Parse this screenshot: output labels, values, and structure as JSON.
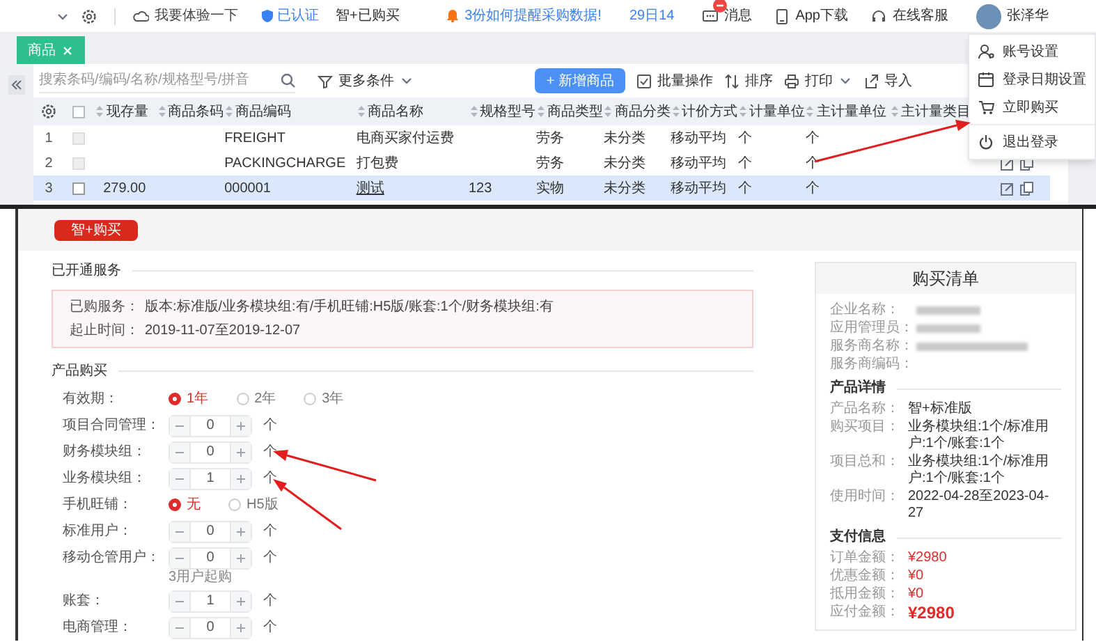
{
  "top_bar": {
    "try_link": "我要体验一下",
    "verified_badge": "已认证",
    "product_name": "智+已购买",
    "notice": "3份如何提醒采购数据!",
    "date": "29日14",
    "messages_label": "消息",
    "app_download": "App下载",
    "support": "在线客服",
    "user_name": "张泽华"
  },
  "tabs": [
    {
      "label": "商品",
      "selected": true
    }
  ],
  "toolbar": {
    "search_placeholder": "搜索条码/编码/名称/规格型号/拼音",
    "filter_button": "更多条件",
    "new_button": "+ 新增商品",
    "batch_button": "批量操作",
    "sort_button": "排序",
    "print_button": "打印",
    "import_button": "导入"
  },
  "table": {
    "select_all": false,
    "columns": [
      "现存量",
      "商品条码",
      "商品编码",
      "商品名称",
      "规格型号",
      "商品类型",
      "商品分类",
      "计价方式",
      "计量单位",
      "主计量单位",
      "主计量类目"
    ],
    "rows": [
      {
        "number": "1",
        "selected": false,
        "checked": false,
        "disabled": true,
        "name_linked": false,
        "cells": [
          "",
          "",
          "FREIGHT",
          "电商买家付运费",
          "",
          "劳务",
          "未分类",
          "移动平均",
          "个",
          "个",
          ""
        ]
      },
      {
        "number": "2",
        "selected": false,
        "checked": false,
        "disabled": true,
        "name_linked": false,
        "cells": [
          "",
          "",
          "PACKINGCHARGE",
          "打包费",
          "",
          "劳务",
          "未分类",
          "移动平均",
          "个",
          "个",
          ""
        ]
      },
      {
        "number": "3",
        "selected": true,
        "checked": false,
        "disabled": false,
        "name_linked": true,
        "cells": [
          "279.00",
          "",
          "000001",
          "测试",
          "123",
          "实物",
          "未分类",
          "移动平均",
          "个",
          "个",
          ""
        ]
      }
    ]
  },
  "user_menu": {
    "items": [
      {
        "label": "账号设置",
        "kind": "account"
      },
      {
        "label": "登录日期设置",
        "kind": "calendar"
      },
      {
        "label": "立即购买",
        "kind": "cart"
      },
      {
        "label": "退出登录",
        "kind": "power"
      }
    ]
  },
  "purchase": {
    "buy_button": "智+购买",
    "services_title": "已开通服务",
    "services": [
      {
        "label": "已购服务：",
        "value": "版本:标准版/业务模块组:有/手机旺铺:H5版/账套:1个/财务模块组:有"
      },
      {
        "label": "起止时间：",
        "value": "2019-11-07至2019-12-07"
      }
    ],
    "product_title": "产品购买",
    "fields": [
      {
        "kind": "radio",
        "label": "有效期：",
        "options": [
          {
            "label": "1年",
            "selected": true
          },
          {
            "label": "2年",
            "selected": false
          },
          {
            "label": "3年",
            "selected": false
          }
        ]
      },
      {
        "kind": "stepper",
        "label": "项目合同管理：",
        "value": "0",
        "unit": "个"
      },
      {
        "kind": "stepper",
        "label": "财务模块组：",
        "value": "0",
        "unit": "个"
      },
      {
        "kind": "stepper",
        "label": "业务模块组：",
        "value": "1",
        "unit": "个"
      },
      {
        "kind": "radio",
        "label": "手机旺铺：",
        "options": [
          {
            "label": "无",
            "selected": true
          },
          {
            "label": "H5版",
            "selected": false
          }
        ]
      },
      {
        "kind": "stepper",
        "label": "标准用户：",
        "value": "0",
        "unit": "个"
      },
      {
        "kind": "stepper",
        "label": "移动仓管用户：",
        "value": "0",
        "unit": "个",
        "hint": "3用户起购"
      },
      {
        "kind": "stepper",
        "label": "账套：",
        "value": "1",
        "unit": "个"
      },
      {
        "kind": "stepper",
        "label": "电商管理：",
        "value": "0",
        "unit": "个"
      }
    ]
  },
  "order_summary": {
    "title": "购买清单",
    "company_labels": [
      "企业名称：",
      "应用管理员：",
      "服务商名称：",
      "服务商编码："
    ],
    "details_title": "产品详情",
    "details": [
      {
        "label": "产品名称：",
        "value": "智+标准版"
      },
      {
        "label": "购买项目：",
        "value": "业务模块组:1个/标准用户:1个/账套:1个"
      },
      {
        "label": "项目总和：",
        "value": "业务模块组:1个/标准用户:1个/账套:1个"
      },
      {
        "label": "使用时间：",
        "value": "2022-04-28至2023-04-27"
      }
    ],
    "payment_title": "支付信息",
    "payment": [
      {
        "label": "订单金额：",
        "value": "¥2980",
        "kind": "amount"
      },
      {
        "label": "优惠金额：",
        "value": "¥0",
        "kind": "amount"
      },
      {
        "label": "抵用金额：",
        "value": "¥0",
        "kind": "amount"
      },
      {
        "label": "应付金额：",
        "value": "¥2980",
        "kind": "total"
      }
    ]
  }
}
